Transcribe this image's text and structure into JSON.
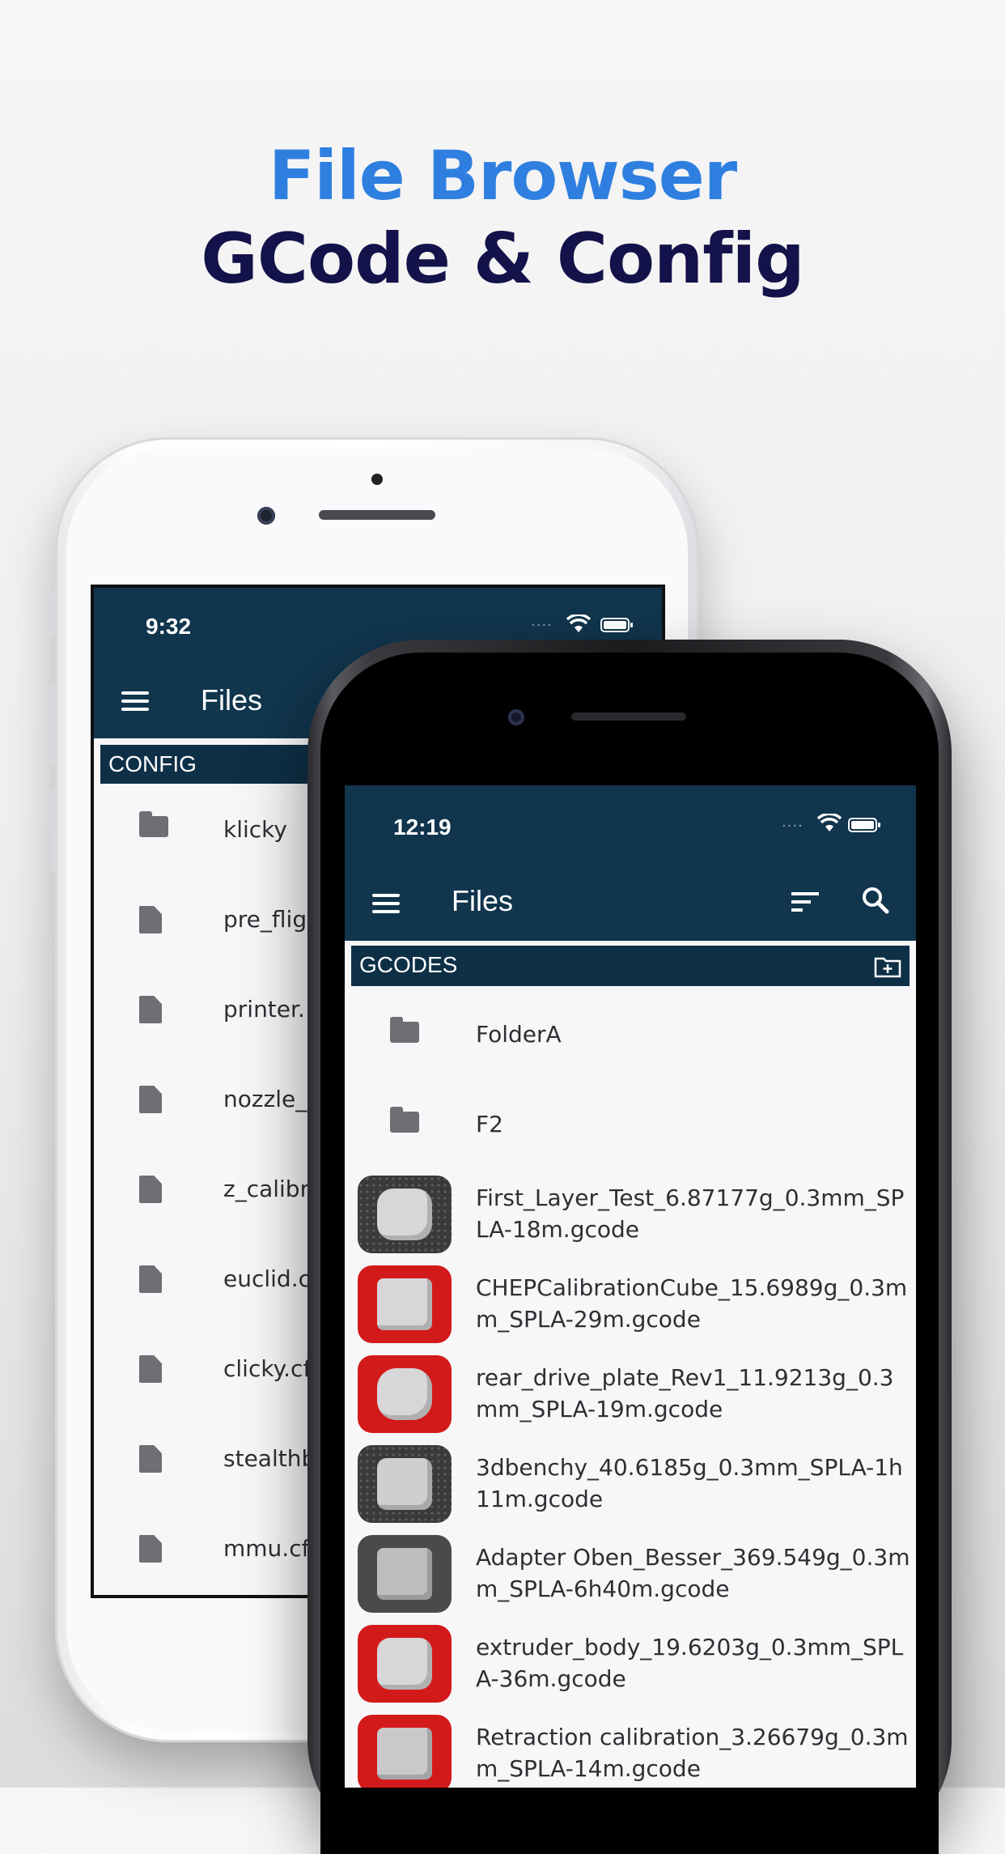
{
  "headline": {
    "line1": "File Browser",
    "line2": "GCode & Config"
  },
  "back_phone": {
    "status_time": "9:32",
    "appbar_title": "Files",
    "section_title": "CONFIG",
    "items": [
      {
        "icon": "folder-icon",
        "label": "klicky"
      },
      {
        "icon": "file-icon",
        "label": "pre_flig"
      },
      {
        "icon": "file-icon",
        "label": "printer."
      },
      {
        "icon": "file-icon",
        "label": "nozzle_"
      },
      {
        "icon": "file-icon",
        "label": "z_calibr"
      },
      {
        "icon": "file-icon",
        "label": "euclid.c"
      },
      {
        "icon": "file-icon",
        "label": "clicky.cf"
      },
      {
        "icon": "file-icon",
        "label": "stealthb"
      },
      {
        "icon": "file-icon",
        "label": "mmu.cf"
      }
    ]
  },
  "front_phone": {
    "status_time": "12:19",
    "appbar_title": "Files",
    "section_title": "GCODES",
    "folders": [
      {
        "icon": "folder-icon",
        "label": "FolderA"
      },
      {
        "icon": "folder-icon",
        "label": "F2"
      }
    ],
    "gcode_files": [
      {
        "label": "First_Layer_Test_6.87177g_0.3mm_SPLA-18m.gcode",
        "thumb_bg": "#3a3a3c"
      },
      {
        "label": "CHEPCalibrationCube_15.6989g_0.3mm_SPLA-29m.gcode",
        "thumb_bg": "#d31a1a"
      },
      {
        "label": "rear_drive_plate_Rev1_11.9213g_0.3mm_SPLA-19m.gcode",
        "thumb_bg": "#d31a1a"
      },
      {
        "label": "3dbenchy_40.6185g_0.3mm_SPLA-1h11m.gcode",
        "thumb_bg": "#3a3a3c"
      },
      {
        "label": "Adapter Oben_Besser_369.549g_0.3mm_SPLA-6h40m.gcode",
        "thumb_bg": "#4a4a4c"
      },
      {
        "label": "extruder_body_19.6203g_0.3mm_SPLA-36m.gcode",
        "thumb_bg": "#d31a1a"
      },
      {
        "label": "Retraction calibration_3.26679g_0.3mm_SPLA-14m.gcode",
        "thumb_bg": "#d31a1a"
      }
    ]
  },
  "colors": {
    "headline_blue": "#2f7fe0",
    "headline_navy": "#14124a",
    "appbar": "#10354d",
    "section_bar": "#0e3047"
  }
}
